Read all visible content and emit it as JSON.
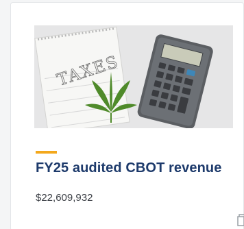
{
  "card": {
    "image": {
      "icon": "taxes-calculator-illustration",
      "notebook_text": "TAXES"
    },
    "accent_color": "#f3a81c",
    "title": "FY25 audited CBOT revenue",
    "value": "$22,609,932",
    "corner_icon": "copy-icon"
  }
}
